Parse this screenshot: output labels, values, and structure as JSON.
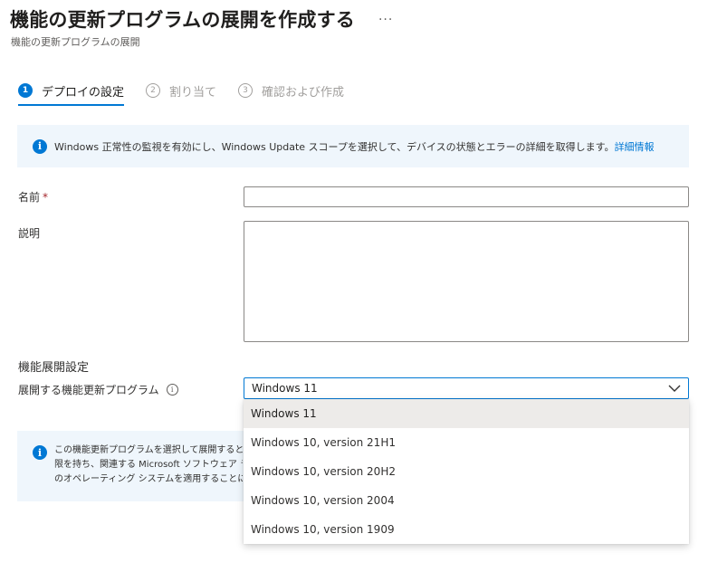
{
  "page": {
    "title": "機能の更新プログラムの展開を作成する",
    "more_label": "···",
    "subtitle": "機能の更新プログラムの展開"
  },
  "steps": [
    {
      "num": "1",
      "label": "デプロイの設定",
      "state": "active"
    },
    {
      "num": "2",
      "label": "割り当て",
      "state": "inactive"
    },
    {
      "num": "3",
      "label": "確認および作成",
      "state": "inactive"
    }
  ],
  "info_banner": {
    "icon": "info-icon",
    "text": "Windows 正常性の監視を有効にし、Windows Update スコープを選択して、デバイスの状態とエラーの詳細を取得します。",
    "link": "詳細情報"
  },
  "form": {
    "name_label": "名前",
    "required_mark": "*",
    "name_value": "",
    "description_label": "説明",
    "description_value": ""
  },
  "feature_settings": {
    "section_title": "機能展開設定",
    "update_label": "展開する機能更新プログラム",
    "info_icon": "info-icon",
    "selected": "Windows 11",
    "options": [
      "Windows 11",
      "Windows 10, version 21H1",
      "Windows 10, version 20H2",
      "Windows 10, version 2004",
      "Windows 10, version 1909"
    ]
  },
  "license_banner": {
    "icon": "info-icon",
    "lines": [
      "この機能更新プログラムを選択して展開すると",
      "限を持ち、関連する Microsoft ソフトウェア ラ",
      "のオペレーティング システムを適用することに同"
    ]
  },
  "colors": {
    "accent": "#0078d4",
    "info_background": "#eff6fc",
    "selected_option": "#edebe9"
  }
}
